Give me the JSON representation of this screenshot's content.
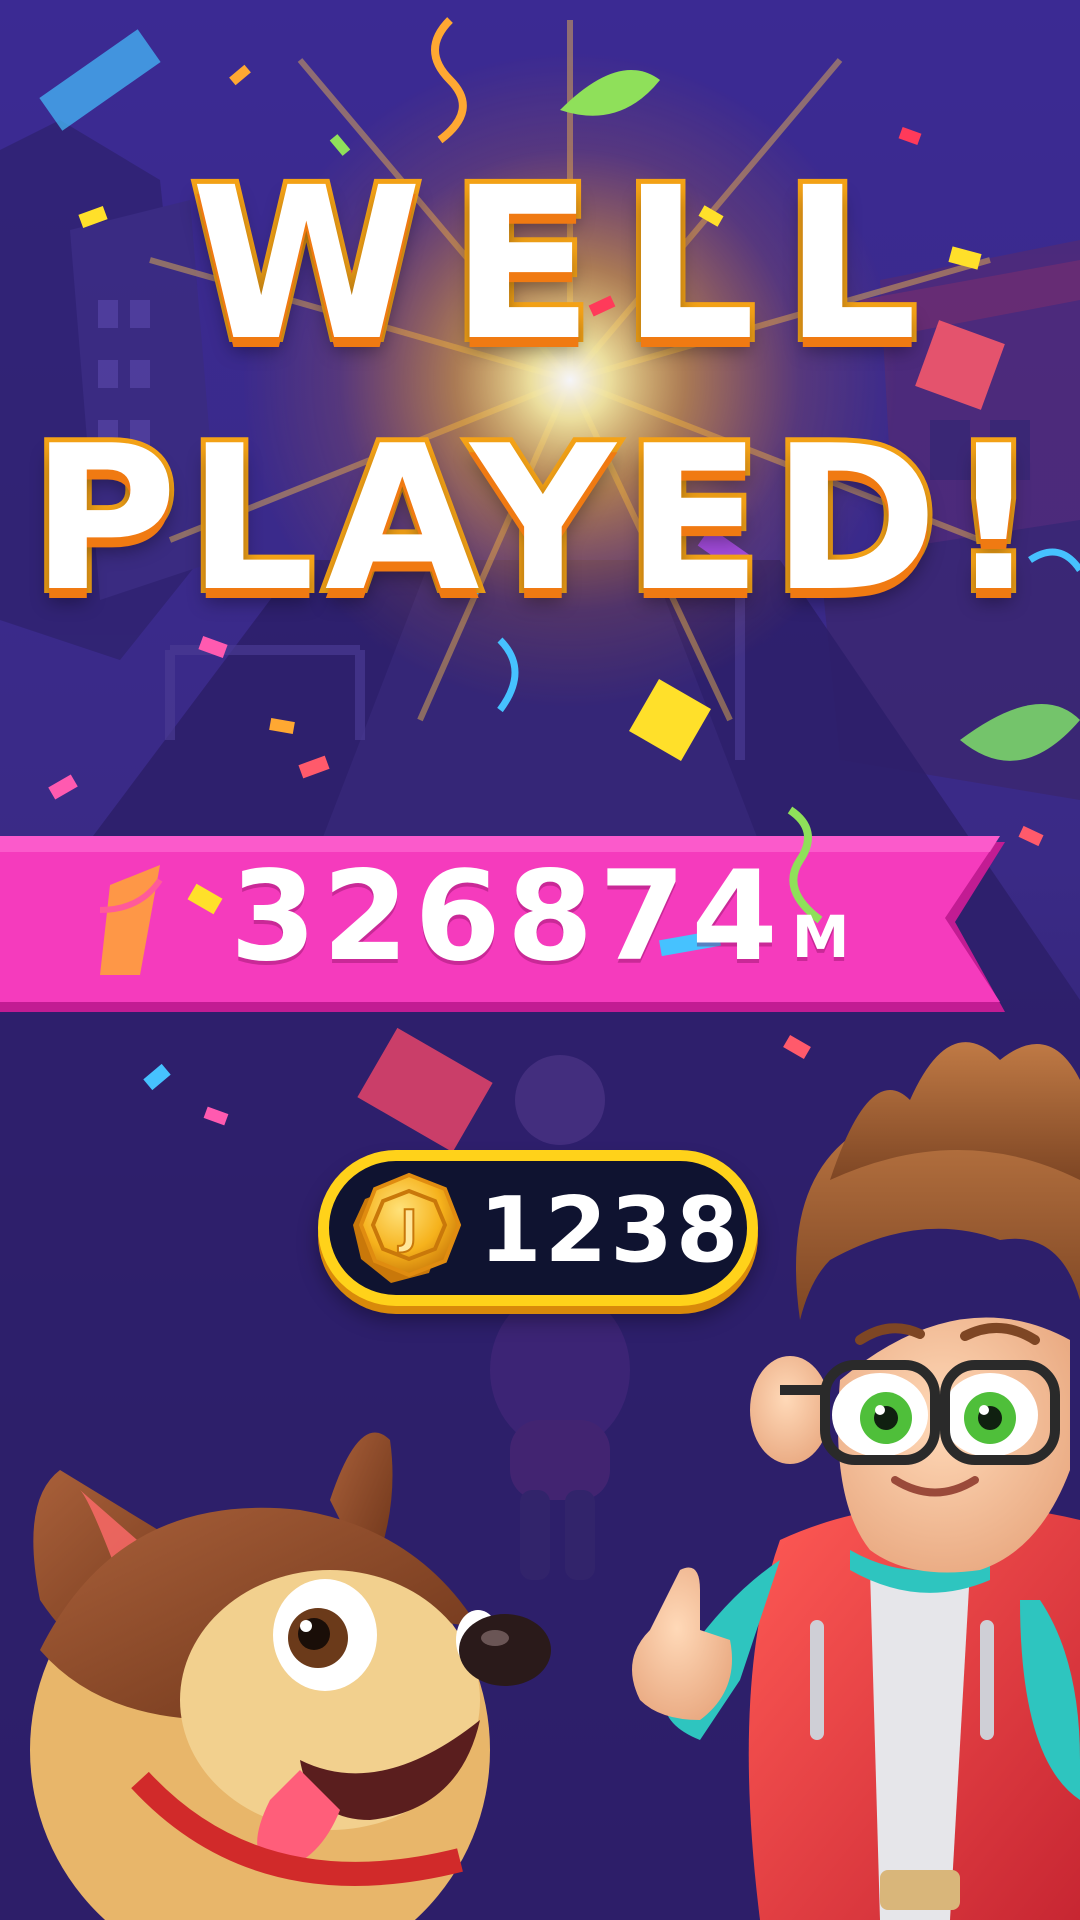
{
  "screen": "game-over-results",
  "title": {
    "line1": "WELL",
    "line2": "PLAYED!"
  },
  "distance": {
    "value": "326874",
    "unit": "M"
  },
  "coins": {
    "count": "1238",
    "icon": "coin-icon",
    "coin_letter": "J"
  },
  "characters": [
    "dog-character",
    "boy-character"
  ],
  "colors": {
    "background": "#2a1d6e",
    "banner": "#f53bbd",
    "title_outline": "#f5a317",
    "coin_pill": "#0f1330",
    "coin_border": "#ffd21a"
  }
}
